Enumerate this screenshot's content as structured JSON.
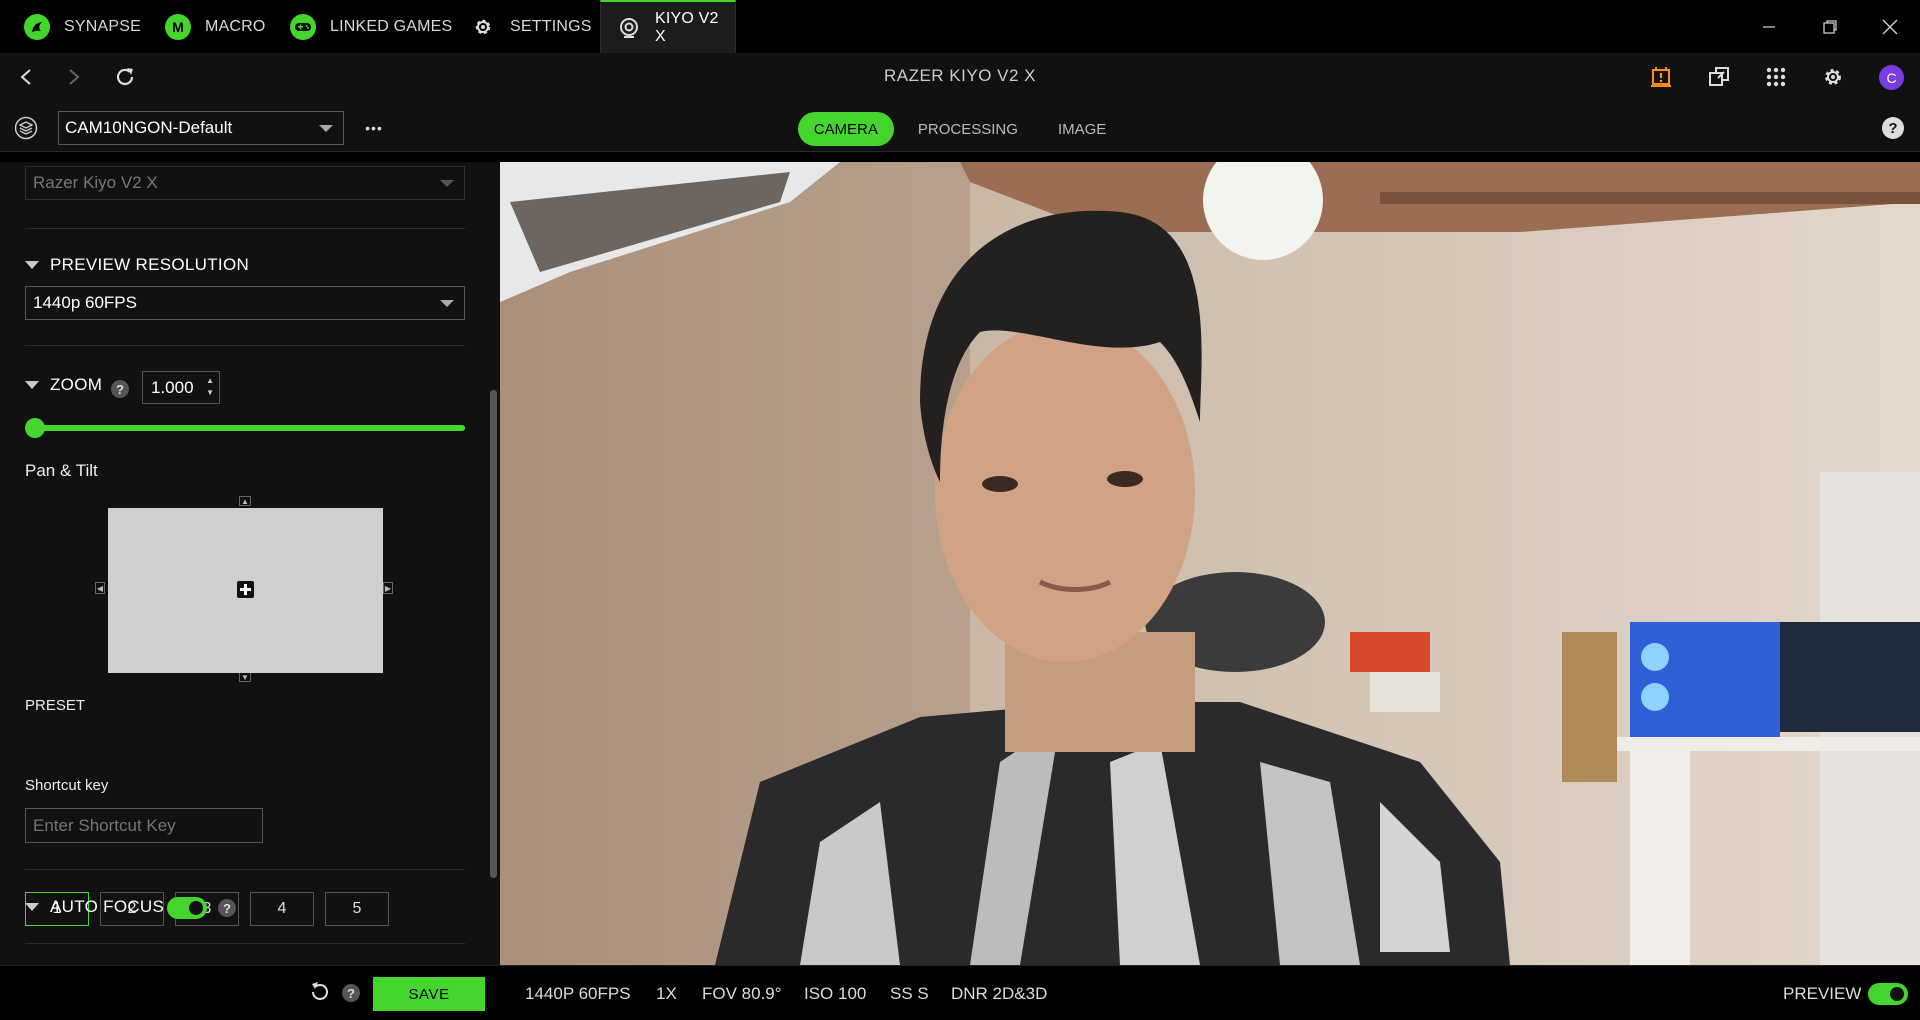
{
  "app_tabs": [
    {
      "label": "SYNAPSE",
      "icon": "razer-snake-icon"
    },
    {
      "label": "MACRO",
      "icon": "macro-m-icon",
      "badge": "M"
    },
    {
      "label": "LINKED GAMES",
      "icon": "gamepad-icon"
    },
    {
      "label": "SETTINGS",
      "icon": "gear-icon"
    },
    {
      "label": "KIYO V2 X",
      "icon": "webcam-icon",
      "active": true
    }
  ],
  "window_controls": [
    "minimize-icon",
    "restore-icon",
    "close-icon"
  ],
  "nav": {
    "heading": "RAZER KIYO V2 X",
    "avatar_letter": "C",
    "help": "?"
  },
  "profile": {
    "selected": "CAM10NGON-Default",
    "more": "•••"
  },
  "device_tabs": [
    {
      "label": "CAMERA",
      "active": true
    },
    {
      "label": "PROCESSING",
      "active": false
    },
    {
      "label": "IMAGE",
      "active": false
    }
  ],
  "sidebar": {
    "device_select": "Razer Kiyo V2 X",
    "preview_resolution": {
      "heading": "PREVIEW RESOLUTION",
      "selected": "1440p 60FPS"
    },
    "zoom": {
      "heading": "ZOOM",
      "value": "1.000",
      "slider_fraction": 0
    },
    "pan_tilt": {
      "label": "Pan & Tilt"
    },
    "preset": {
      "label": "PRESET",
      "buttons": [
        "1",
        "2",
        "3",
        "4",
        "5"
      ],
      "selected": "1"
    },
    "shortcut": {
      "label": "Shortcut key",
      "placeholder": "Enter Shortcut Key"
    },
    "auto_focus": {
      "heading": "AUTO FOCUS",
      "enabled": true
    }
  },
  "bottom": {
    "save_label": "SAVE",
    "stats": [
      "1440P 60FPS",
      "1X",
      "FOV 80.9°",
      "ISO 100",
      "SS S",
      "DNR 2D&3D"
    ],
    "preview_label": "PREVIEW",
    "preview_enabled": true
  },
  "colors": {
    "accent": "#44d62c",
    "warning": "#ff8c1a",
    "avatar": "#7a3ce0"
  }
}
